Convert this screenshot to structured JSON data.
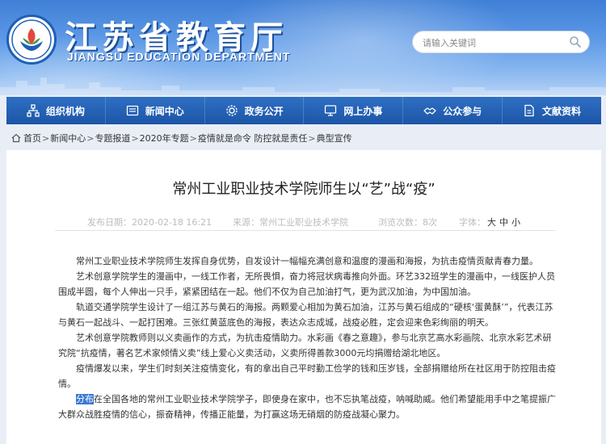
{
  "header": {
    "title": "江苏省教育厅",
    "subtitle": "JIANGSU EDUCATION DEPARTMENT"
  },
  "search": {
    "placeholder": "请输入关键词"
  },
  "nav": {
    "items": [
      {
        "label": "组织机构",
        "icon": "org-chart-icon"
      },
      {
        "label": "新闻中心",
        "icon": "news-icon"
      },
      {
        "label": "政务公开",
        "icon": "gear-icon"
      },
      {
        "label": "网上办事",
        "icon": "monitor-icon"
      },
      {
        "label": "公众参与",
        "icon": "handshake-icon"
      },
      {
        "label": "文献资料",
        "icon": "document-icon"
      }
    ]
  },
  "breadcrumb": {
    "items": [
      "首页",
      "新闻中心",
      "专题报道",
      "2020年专题",
      "疫情就是命令 防控就是责任",
      "典型宣传"
    ],
    "separator": ">"
  },
  "article": {
    "title": "常州工业职业技术学院师生以“艺”战“疫”",
    "publish_label": "发布日期：2020-02-18 16:21",
    "source_label": "来源：常州工业职业技术学院",
    "views_label": "浏览次数：8次",
    "font_size_label": "字体：",
    "font_size_large": "大",
    "font_size_medium": "中",
    "font_size_small": "小",
    "paragraphs": [
      "常州工业职业技术学院师生发挥自身优势，自发设计一幅幅充满创意和温度的漫画和海报，为抗击疫情贡献青春力量。",
      "艺术创意学院学生的漫画中，一线工作者，无所畏惧，奋力将冠状病毒推向外面。环艺332班学生的漫画中，一线医护人员围成半圆，每个人伸出一只手，紧紧团结在一起。他们不仅为自己加油打气，更为武汉加油，为中国加油。",
      "轨道交通学院学生设计了一组江苏与黄石的海报。两颗爱心相加为黄石加油，江苏与黄石组成的“硬核‘蛋黄酥’”，代表江苏与黄石一起战斗、一起打困难。三张红黄蓝底色的海报，表达众志成城，战疫必胜，定会迎来色彩绚丽的明天。",
      "艺术创意学院教师则以义卖画作的方式，为抗击疫情助力。水彩画《春之意趣》，参与北京艺高水彩画院、北京水彩艺术研究院“抗疫情，著名艺术家倾情义卖”线上爱心义卖活动，义卖所得善款3000元均捐赠给湖北地区。",
      "疫情爆发以来，学生们时刻关注疫情变化，有的拿出自己平时勤工俭学的钱和压岁钱，全部捐赠给所在社区用于防控阻击疫情。"
    ],
    "last_paragraph_highlight": "分布",
    "last_paragraph_rest": "在全国各地的常州工业职业技术学院学子，即使身在家中，也不忘执笔战疫，呐喊助威。他们希望能用手中之笔提振广大群众战胜疫情的信心，振奋精神，传播正能量，为打赢这场无硝烟的防疫战凝心聚力。"
  },
  "colors": {
    "nav_bg": "#1c55a6",
    "header_top": "#3f7fd6",
    "highlight": "#3d79d3"
  }
}
